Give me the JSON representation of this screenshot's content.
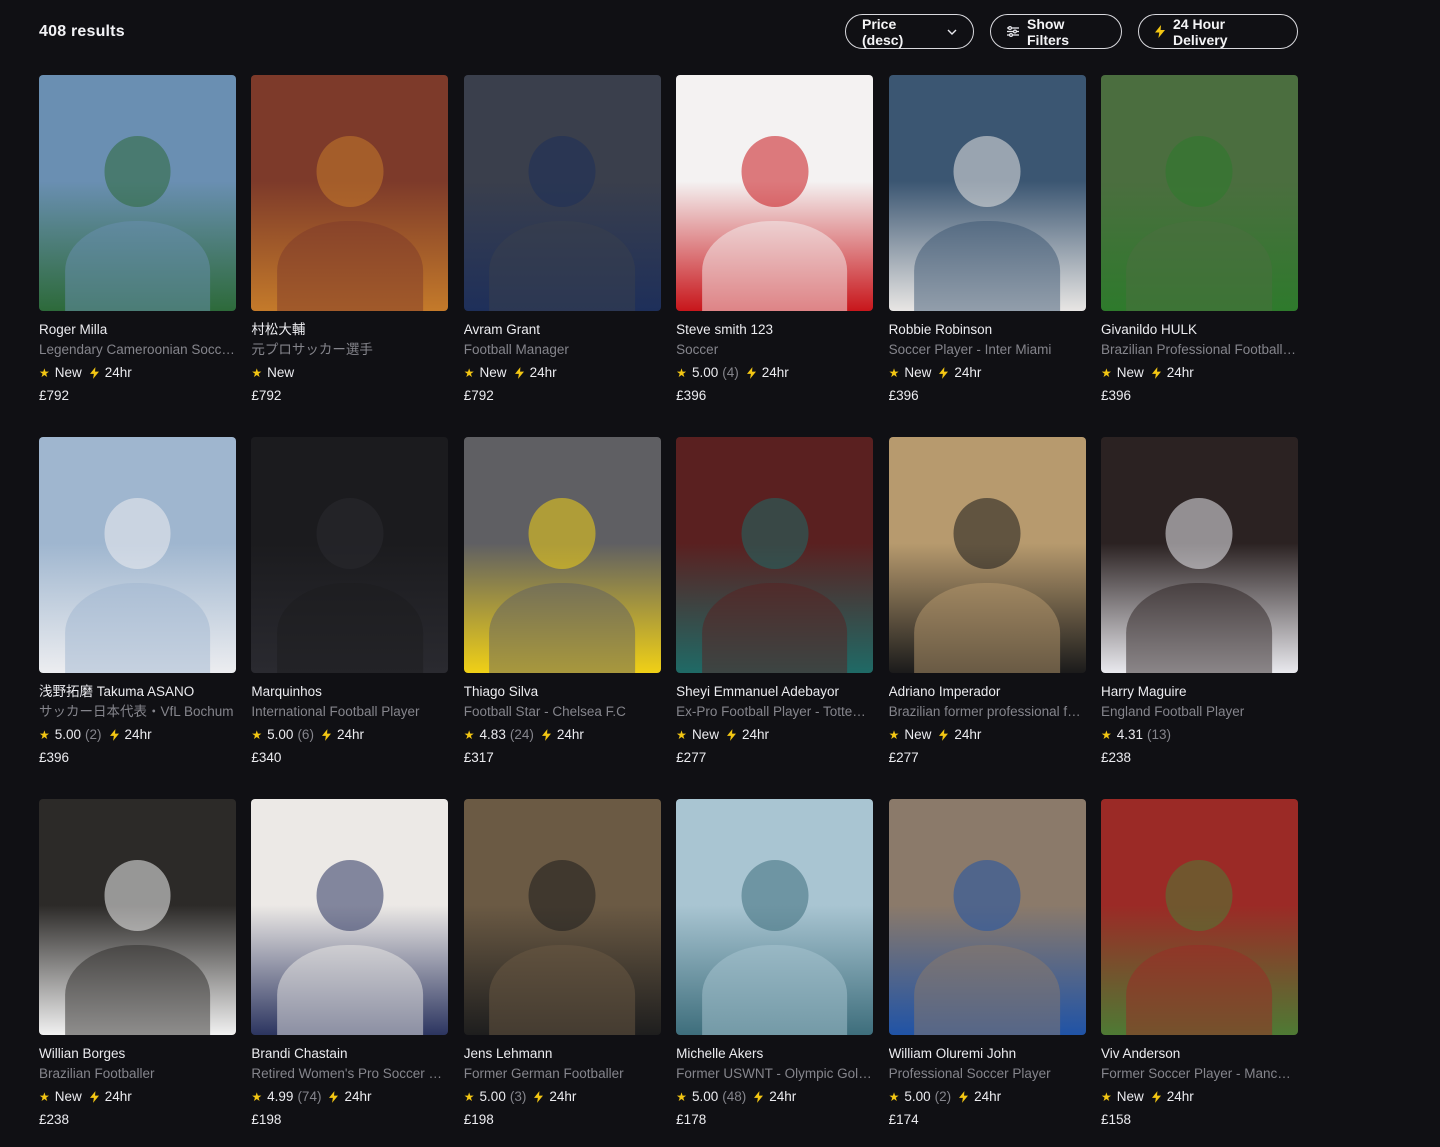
{
  "results_label": "408 results",
  "controls": {
    "sort_label": "Price (desc)",
    "filters_label": "Show Filters",
    "delivery_label": "24 Hour Delivery"
  },
  "colors": {
    "star": "#f3c613",
    "background": "#101014"
  },
  "cards": [
    {
      "name": "Roger Milla",
      "subtitle": "Legendary Cameroonian Soccer Player",
      "rating_text": "New",
      "reviews": "",
      "fast": "24hr",
      "price": "£792",
      "tone": [
        "#6a8fb2",
        "#2d6a3a"
      ]
    },
    {
      "name": "村松大輔",
      "subtitle": "元プロサッカー選手",
      "rating_text": "New",
      "reviews": "",
      "fast": "",
      "price": "£792",
      "tone": [
        "#7d3a2a",
        "#c47a2a"
      ]
    },
    {
      "name": "Avram Grant",
      "subtitle": "Football Manager",
      "rating_text": "New",
      "reviews": "",
      "fast": "24hr",
      "price": "£792",
      "tone": [
        "#3a3f4c",
        "#1e2f5a"
      ]
    },
    {
      "name": "Steve smith 123",
      "subtitle": "Soccer",
      "rating_text": "5.00",
      "reviews": "(4)",
      "fast": "24hr",
      "price": "£396",
      "tone": [
        "#f4f2f2",
        "#c8161b"
      ]
    },
    {
      "name": "Robbie Robinson",
      "subtitle": "Soccer Player - Inter Miami",
      "rating_text": "New",
      "reviews": "",
      "fast": "24hr",
      "price": "£396",
      "tone": [
        "#3b5672",
        "#e8e6e4"
      ]
    },
    {
      "name": "Givanildo HULK",
      "subtitle": "Brazilian Professional Football Player",
      "rating_text": "New",
      "reviews": "",
      "fast": "24hr",
      "price": "£396",
      "tone": [
        "#4b6e3f",
        "#2e7a2c"
      ]
    },
    {
      "name": "浅野拓磨 Takuma ASANO",
      "subtitle": "サッカー日本代表・VfL Bochum",
      "rating_text": "5.00",
      "reviews": "(2)",
      "fast": "24hr",
      "price": "£396",
      "tone": [
        "#9fb6cf",
        "#ecedf0"
      ]
    },
    {
      "name": "Marquinhos",
      "subtitle": "International Football Player",
      "rating_text": "5.00",
      "reviews": "(6)",
      "fast": "24hr",
      "price": "£340",
      "tone": [
        "#1b1b1e",
        "#2a2a30"
      ]
    },
    {
      "name": "Thiago Silva",
      "subtitle": "Football Star - Chelsea F.C",
      "rating_text": "4.83",
      "reviews": "(24)",
      "fast": "24hr",
      "price": "£317",
      "tone": [
        "#5f5f63",
        "#f0d016"
      ]
    },
    {
      "name": "Sheyi Emmanuel Adebayor",
      "subtitle": "Ex-Pro Football Player - Tottenham",
      "rating_text": "New",
      "reviews": "",
      "fast": "24hr",
      "price": "£277",
      "tone": [
        "#5a2020",
        "#1f6a66"
      ]
    },
    {
      "name": "Adriano Imperador",
      "subtitle": "Brazilian former professional footballer",
      "rating_text": "New",
      "reviews": "",
      "fast": "24hr",
      "price": "£277",
      "tone": [
        "#b79a6e",
        "#1b1b1b"
      ]
    },
    {
      "name": "Harry Maguire",
      "subtitle": "England Football Player",
      "rating_text": "4.31",
      "reviews": "(13)",
      "fast": "",
      "price": "£238",
      "tone": [
        "#2b2222",
        "#e9e9ee"
      ]
    },
    {
      "name": "Willian Borges",
      "subtitle": "Brazilian Footballer",
      "rating_text": "New",
      "reviews": "",
      "fast": "24hr",
      "price": "£238",
      "tone": [
        "#2c2a28",
        "#f1f1f1"
      ]
    },
    {
      "name": "Brandi Chastain",
      "subtitle": "Retired Women's Pro Soccer Player",
      "rating_text": "4.99",
      "reviews": "(74)",
      "fast": "24hr",
      "price": "£198",
      "tone": [
        "#ece9e6",
        "#2c3560"
      ]
    },
    {
      "name": "Jens Lehmann",
      "subtitle": "Former German Footballer",
      "rating_text": "5.00",
      "reviews": "(3)",
      "fast": "24hr",
      "price": "£198",
      "tone": [
        "#6b5a44",
        "#1e1e1e"
      ]
    },
    {
      "name": "Michelle Akers",
      "subtitle": "Former USWNT - Olympic Gold Medalist",
      "rating_text": "5.00",
      "reviews": "(48)",
      "fast": "24hr",
      "price": "£178",
      "tone": [
        "#a9c5d2",
        "#3e6e7c"
      ]
    },
    {
      "name": "William Oluremi John",
      "subtitle": "Professional Soccer Player",
      "rating_text": "5.00",
      "reviews": "(2)",
      "fast": "24hr",
      "price": "£174",
      "tone": [
        "#8b7a6a",
        "#2053a6"
      ]
    },
    {
      "name": "Viv Anderson",
      "subtitle": "Former Soccer Player - Manchester United",
      "rating_text": "New",
      "reviews": "",
      "fast": "24hr",
      "price": "£158",
      "tone": [
        "#9b2a26",
        "#4e7a34"
      ]
    }
  ]
}
